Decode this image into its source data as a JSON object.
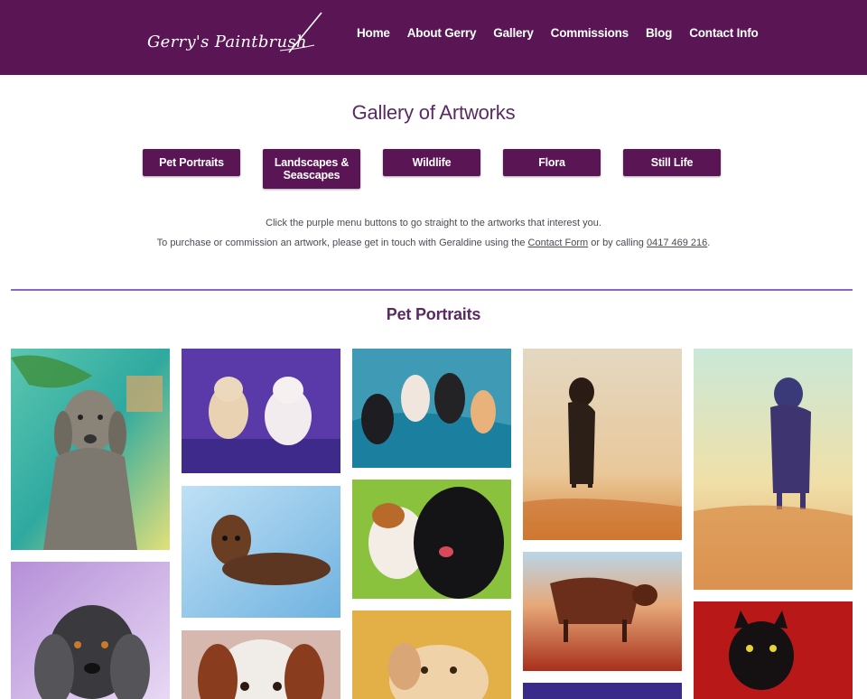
{
  "header": {
    "logo_text": "Gerry's Paintbrush",
    "nav": [
      "Home",
      "About Gerry",
      "Gallery",
      "Commissions",
      "Blog",
      "Contact Info"
    ]
  },
  "page_title": "Gallery of Artworks",
  "categories": [
    "Pet Portraits",
    "Landscapes & Seascapes",
    "Wildlife",
    "Flora",
    "Still Life"
  ],
  "intro": {
    "line1": "Click the purple menu buttons to go straight to the artworks that interest you.",
    "line2_before": "To purchase or commission an artwork, please get in touch with Geraldine using the ",
    "contact_link": "Contact Form",
    "line2_middle": " or by calling ",
    "phone": "0417 469 216",
    "line2_after": "."
  },
  "section_title": "Pet Portraits",
  "colors": {
    "brand": "#5a1554",
    "divider": "#8a68c4"
  }
}
